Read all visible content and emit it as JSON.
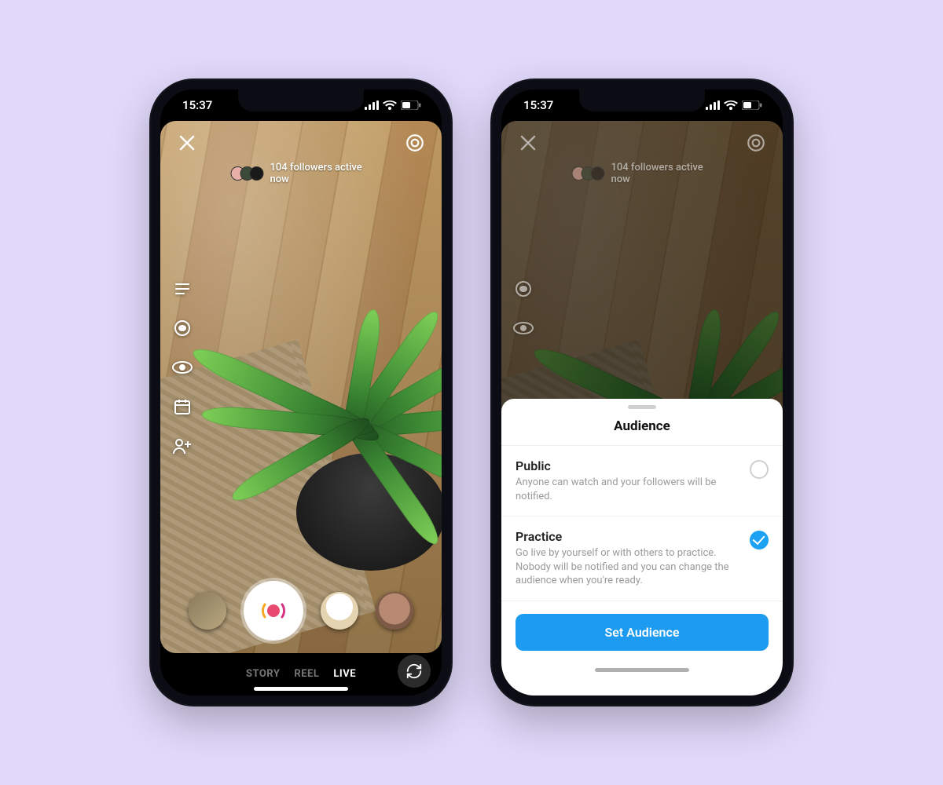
{
  "status": {
    "time": "15:37"
  },
  "camera": {
    "followers_active": "104 followers active now",
    "modes": [
      "STORY",
      "REEL",
      "LIVE"
    ],
    "active_mode": "LIVE"
  },
  "side_tools": [
    "title-icon",
    "donate-icon",
    "audience-icon",
    "schedule-icon",
    "invite-icon"
  ],
  "effect_thumbs": [
    "media-gallery",
    "glasses-filter",
    "face-filter"
  ],
  "sheet": {
    "title": "Audience",
    "options": [
      {
        "title": "Public",
        "description": "Anyone can watch and your followers will be notified.",
        "selected": false
      },
      {
        "title": "Practice",
        "description": "Go live by yourself or with others to practice. Nobody will be notified and you can change the audience when you're ready.",
        "selected": true
      }
    ],
    "cta": "Set Audience"
  }
}
